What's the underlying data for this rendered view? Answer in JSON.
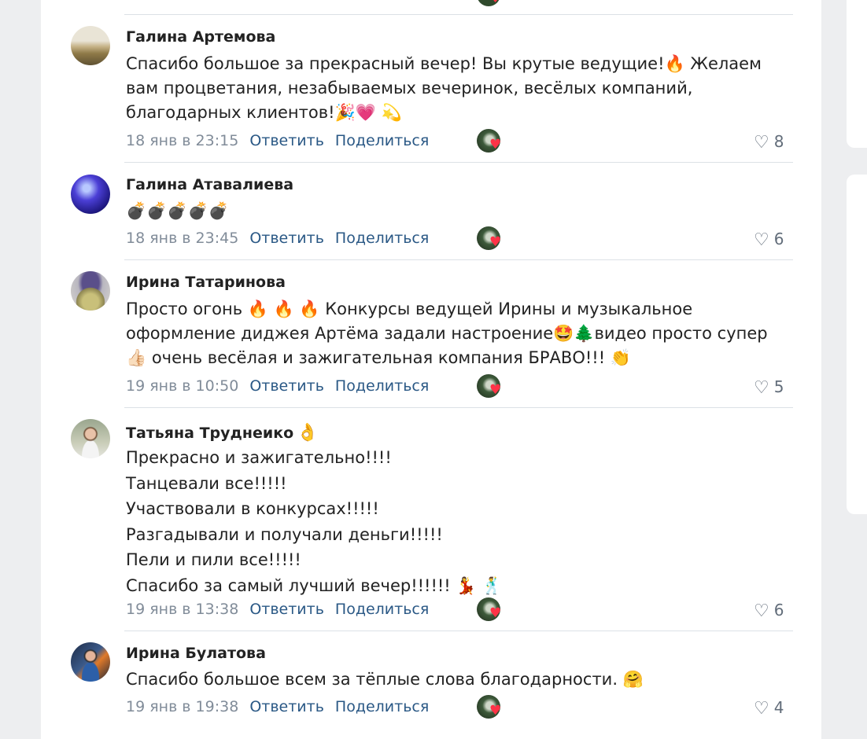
{
  "actions": {
    "reply": "Ответить",
    "share": "Поделиться"
  },
  "comments": [
    {
      "author": "Галина Артемова",
      "author_extra": "",
      "lines": [
        "Спасибо большое за прекрасный вечер! Вы крутые ведущие!🔥 Желаем",
        "вам процветания, незабываемых вечеринок, весёлых компаний,",
        "благодарных клиентов!🎉💗 💫"
      ],
      "date": "18 янв в 23:15",
      "likes": "8"
    },
    {
      "author": "Галина Атавалиева",
      "author_extra": "",
      "lines": [
        "💣💣💣💣💣"
      ],
      "date": "18 янв в 23:45",
      "likes": "6"
    },
    {
      "author": "Ирина Татаринова",
      "author_extra": "",
      "lines": [
        "Просто огонь 🔥 🔥 🔥 Конкурсы ведущей Ирины и музыкальное",
        "оформление диджея Артёма задали настроение🤩🌲видео просто супер",
        "👍🏻 очень весёлая и зажигательная компания БРАВО!!! 👏"
      ],
      "date": "19 янв в 10:50",
      "likes": "5"
    },
    {
      "author": "Татьяна Труднеико",
      "author_extra": "👌",
      "lines": [
        "Прекрасно и зажигательно!!!!",
        "Танцевали все!!!!!",
        "Участвовали в конкурсах!!!!!",
        "Разгадывали и получали деньги!!!!!",
        "Пели и пили все!!!!!",
        "Спасибо за самый лучший вечер!!!!!! 💃 🕺"
      ],
      "date": "19 янв в 13:38",
      "likes": "6"
    },
    {
      "author": "Ирина Булатова",
      "author_extra": "",
      "lines": [
        "Спасибо большое всем за тёплые слова благодарности. 🤗"
      ],
      "date": "19 янв в 19:38",
      "likes": "4"
    }
  ],
  "icons": {
    "like": "heart-outline-icon",
    "liker_badge": "heart-icon"
  },
  "colors": {
    "link": "#2a5885",
    "meta": "#818c99",
    "heart": "#ff3347",
    "background": "#edeef0"
  }
}
